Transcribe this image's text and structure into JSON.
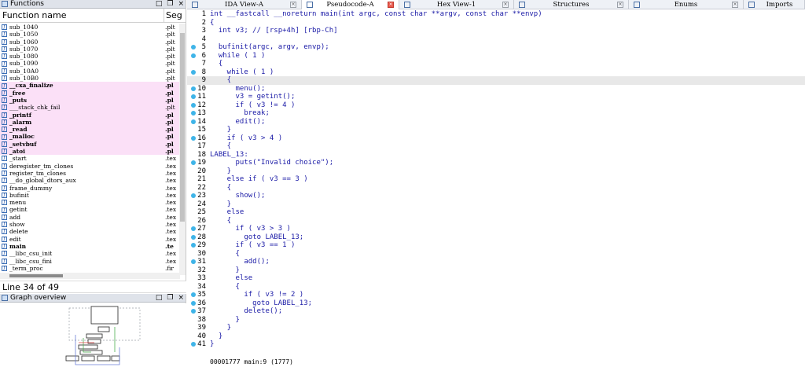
{
  "functions_panel": {
    "title": "Functions",
    "col_name": "Function name",
    "col_seg": "Seg",
    "rows": [
      {
        "name": "sub_1040",
        "seg": ".plt",
        "style": "normal"
      },
      {
        "name": "sub_1050",
        "seg": ".plt",
        "style": "normal"
      },
      {
        "name": "sub_1060",
        "seg": ".plt",
        "style": "normal"
      },
      {
        "name": "sub_1070",
        "seg": ".plt",
        "style": "normal"
      },
      {
        "name": "sub_1080",
        "seg": ".plt",
        "style": "normal"
      },
      {
        "name": "sub_1090",
        "seg": ".plt",
        "style": "normal"
      },
      {
        "name": "sub_10A0",
        "seg": ".plt",
        "style": "normal"
      },
      {
        "name": "sub_10B0",
        "seg": ".plt",
        "style": "normal"
      },
      {
        "name": "__cxa_finalize",
        "seg": ".pl",
        "style": "pink-bold"
      },
      {
        "name": "_free",
        "seg": ".pl",
        "style": "pink-bold"
      },
      {
        "name": "_puts",
        "seg": ".pl",
        "style": "pink-bold"
      },
      {
        "name": "___stack_chk_fail",
        "seg": ".plt",
        "style": "pink"
      },
      {
        "name": "_printf",
        "seg": ".pl",
        "style": "pink-bold"
      },
      {
        "name": "_alarm",
        "seg": ".pl",
        "style": "pink-bold"
      },
      {
        "name": "_read",
        "seg": ".pl",
        "style": "pink-bold"
      },
      {
        "name": "_malloc",
        "seg": ".pl",
        "style": "pink-bold"
      },
      {
        "name": "_setvbuf",
        "seg": ".pl",
        "style": "pink-bold"
      },
      {
        "name": "_atoi",
        "seg": ".pl",
        "style": "pink-bold"
      },
      {
        "name": "_start",
        "seg": ".tex",
        "style": "normal"
      },
      {
        "name": "deregister_tm_clones",
        "seg": ".tex",
        "style": "normal"
      },
      {
        "name": "register_tm_clones",
        "seg": ".tex",
        "style": "normal"
      },
      {
        "name": "__do_global_dtors_aux",
        "seg": ".tex",
        "style": "normal"
      },
      {
        "name": "frame_dummy",
        "seg": ".tex",
        "style": "normal"
      },
      {
        "name": "bufinit",
        "seg": ".tex",
        "style": "normal"
      },
      {
        "name": "menu",
        "seg": ".tex",
        "style": "normal"
      },
      {
        "name": "getint",
        "seg": ".tex",
        "style": "normal"
      },
      {
        "name": "add",
        "seg": ".tex",
        "style": "normal"
      },
      {
        "name": "show",
        "seg": ".tex",
        "style": "normal"
      },
      {
        "name": "delete",
        "seg": ".tex",
        "style": "normal"
      },
      {
        "name": "edit",
        "seg": ".tex",
        "style": "normal"
      },
      {
        "name": "main",
        "seg": ".te",
        "style": "bold"
      },
      {
        "name": "__libc_csu_init",
        "seg": ".tex",
        "style": "normal"
      },
      {
        "name": "__libc_csu_fini",
        "seg": ".tex",
        "style": "normal"
      },
      {
        "name": "_term_proc",
        "seg": ".fir",
        "style": "normal"
      }
    ]
  },
  "line_status": "Line 34 of 49",
  "graph_panel": {
    "title": "Graph overview"
  },
  "tabs": [
    {
      "label": "IDA View-A",
      "icon": "ida-view-icon",
      "active": false
    },
    {
      "label": "Pseudocode-A",
      "icon": "pseudocode-icon",
      "active": true
    },
    {
      "label": "Hex View-1",
      "icon": "hex-view-icon",
      "active": false
    },
    {
      "label": "Structures",
      "icon": "structures-icon",
      "active": false
    },
    {
      "label": "Enums",
      "icon": "enums-icon",
      "active": false
    },
    {
      "label": "Imports",
      "icon": "imports-icon",
      "active": false
    }
  ],
  "code_lines": [
    {
      "n": "1",
      "bp": false,
      "text": "int __fastcall __noreturn main(int argc, const char **argv, const char **envp)"
    },
    {
      "n": "2",
      "bp": false,
      "text": "{"
    },
    {
      "n": "3",
      "bp": false,
      "text": "  int v3; // [rsp+4h] [rbp-Ch]"
    },
    {
      "n": "4",
      "bp": false,
      "text": ""
    },
    {
      "n": "5",
      "bp": true,
      "text": "  bufinit(argc, argv, envp);"
    },
    {
      "n": "6",
      "bp": true,
      "text": "  while ( 1 )"
    },
    {
      "n": "7",
      "bp": false,
      "text": "  {"
    },
    {
      "n": "8",
      "bp": true,
      "text": "    while ( 1 )"
    },
    {
      "n": "9",
      "bp": false,
      "text": "    {"
    },
    {
      "n": "10",
      "bp": true,
      "text": "      menu();"
    },
    {
      "n": "11",
      "bp": true,
      "text": "      v3 = getint();"
    },
    {
      "n": "12",
      "bp": true,
      "text": "      if ( v3 != 4 )"
    },
    {
      "n": "13",
      "bp": true,
      "text": "        break;"
    },
    {
      "n": "14",
      "bp": true,
      "text": "      edit();"
    },
    {
      "n": "15",
      "bp": false,
      "text": "    }"
    },
    {
      "n": "16",
      "bp": true,
      "text": "    if ( v3 > 4 )"
    },
    {
      "n": "17",
      "bp": false,
      "text": "    {"
    },
    {
      "n": "18",
      "bp": false,
      "text": "LABEL_13:"
    },
    {
      "n": "19",
      "bp": true,
      "text": "      puts(\"Invalid choice\");"
    },
    {
      "n": "20",
      "bp": false,
      "text": "    }"
    },
    {
      "n": "21",
      "bp": false,
      "text": "    else if ( v3 == 3 )"
    },
    {
      "n": "22",
      "bp": false,
      "text": "    {"
    },
    {
      "n": "23",
      "bp": true,
      "text": "      show();"
    },
    {
      "n": "24",
      "bp": false,
      "text": "    }"
    },
    {
      "n": "25",
      "bp": false,
      "text": "    else"
    },
    {
      "n": "26",
      "bp": false,
      "text": "    {"
    },
    {
      "n": "27",
      "bp": true,
      "text": "      if ( v3 > 3 )"
    },
    {
      "n": "28",
      "bp": true,
      "text": "        goto LABEL_13;"
    },
    {
      "n": "29",
      "bp": true,
      "text": "      if ( v3 == 1 )"
    },
    {
      "n": "30",
      "bp": false,
      "text": "      {"
    },
    {
      "n": "31",
      "bp": true,
      "text": "        add();"
    },
    {
      "n": "32",
      "bp": false,
      "text": "      }"
    },
    {
      "n": "33",
      "bp": false,
      "text": "      else"
    },
    {
      "n": "34",
      "bp": false,
      "text": "      {"
    },
    {
      "n": "35",
      "bp": true,
      "text": "        if ( v3 != 2 )"
    },
    {
      "n": "36",
      "bp": true,
      "text": "          goto LABEL_13;"
    },
    {
      "n": "37",
      "bp": true,
      "text": "        delete();"
    },
    {
      "n": "38",
      "bp": false,
      "text": "      }"
    },
    {
      "n": "39",
      "bp": false,
      "text": "    }"
    },
    {
      "n": "40",
      "bp": false,
      "text": "  }"
    },
    {
      "n": "41",
      "bp": true,
      "text": "}"
    }
  ],
  "highlight_line": "9",
  "statusbar": "00001777 main:9 (1777)",
  "colors": {
    "breakpoint": "#3fb4e8",
    "pink_row": "#fbe0f7",
    "code_text": "#1a1aa6",
    "var_text": "#6b7fc2",
    "string_text": "#1a8a1a"
  }
}
